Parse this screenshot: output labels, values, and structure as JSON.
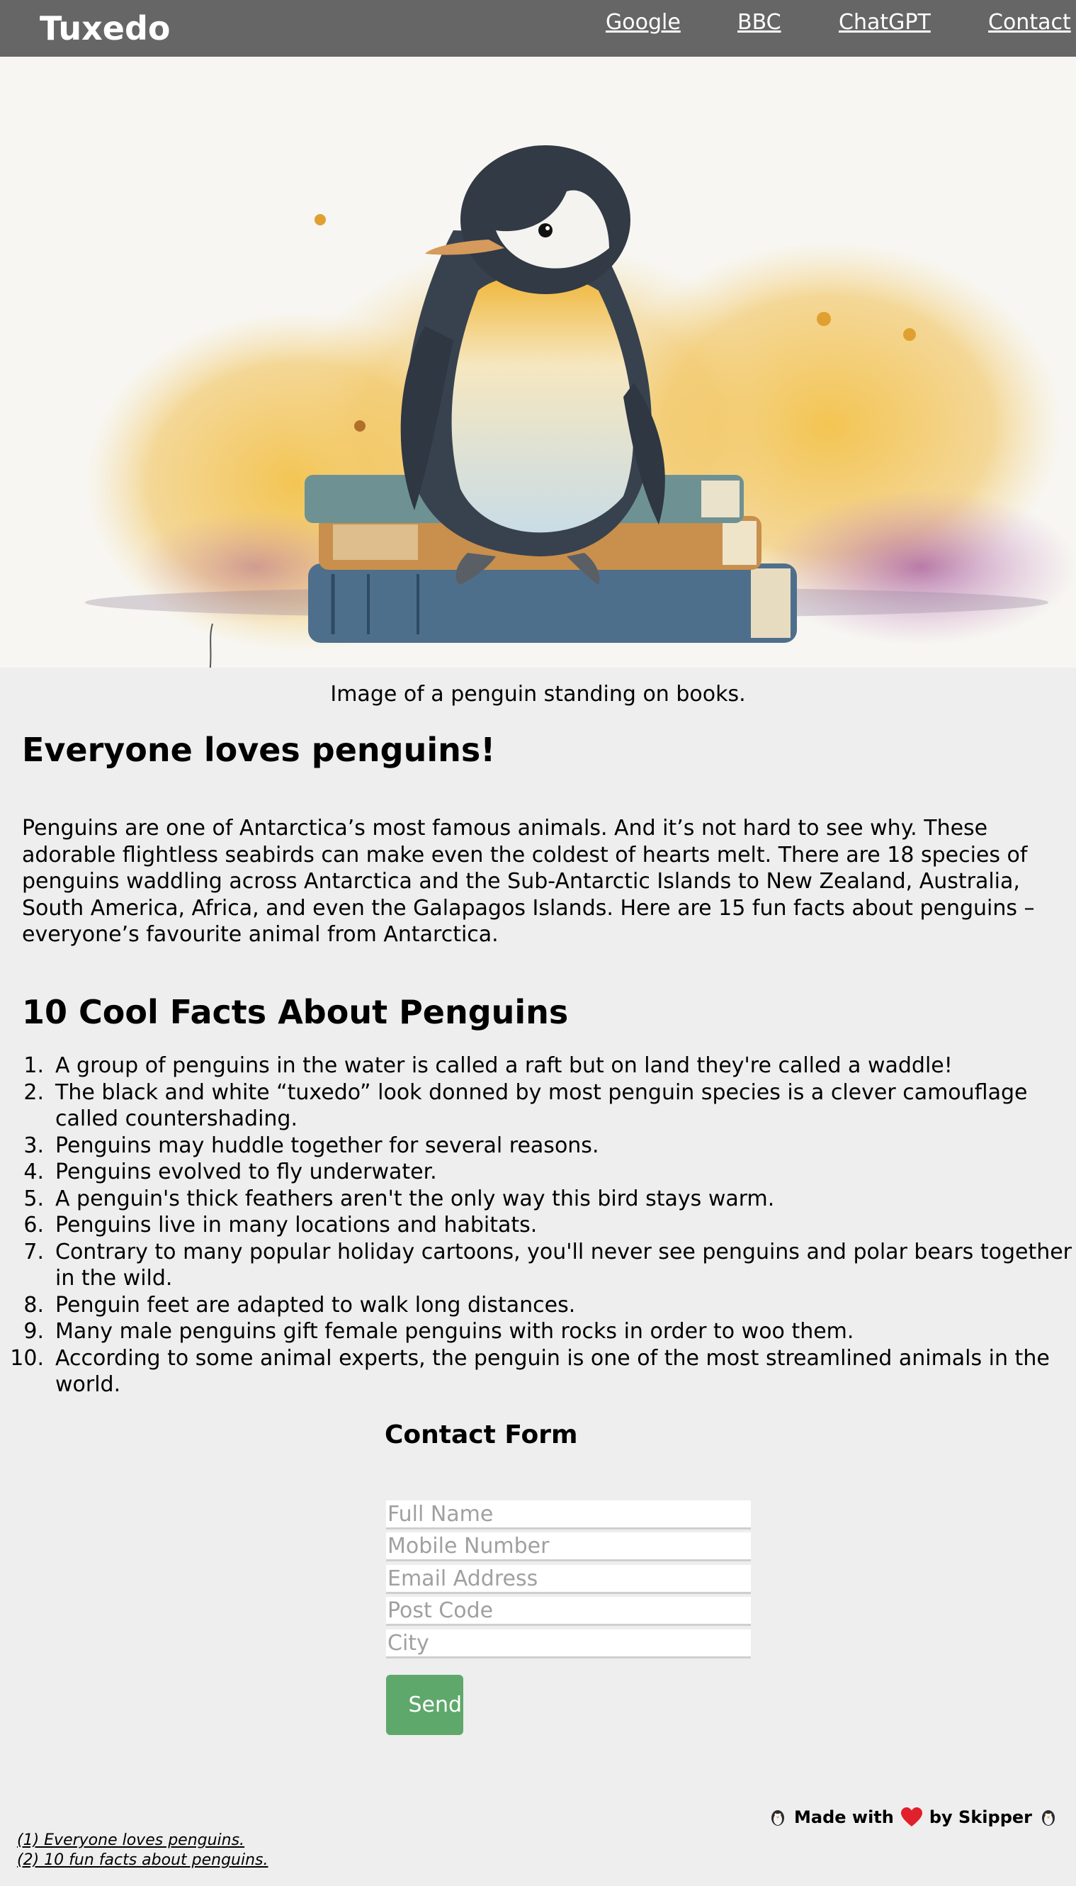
{
  "navbar": {
    "brand": "Tuxedo",
    "links": [
      {
        "label": "Google"
      },
      {
        "label": "BBC"
      },
      {
        "label": "ChatGPT"
      },
      {
        "label": "Contact"
      }
    ],
    "background": "#666666"
  },
  "hero": {
    "caption": "Image of a penguin standing on books."
  },
  "article": {
    "heading": "Everyone loves penguins!",
    "intro": "Penguins are one of Antarctica’s most famous animals. And it’s not hard to see why. These adorable flightless seabirds can make even the coldest of hearts melt. There are 18 species of penguins waddling across Antarctica and the Sub-Antarctic Islands to New Zealand, Australia, South America, Africa, and even the Galapagos Islands. Here are 15 fun facts about penguins – everyone’s favourite animal from Antarctica.",
    "facts_heading": "10 Cool Facts About Penguins",
    "facts": [
      {
        "num": "1.",
        "text": "A group of penguins in the water is called a raft but on land they're called a waddle!"
      },
      {
        "num": "2.",
        "text": "The black and white “tuxedo” look donned by most penguin species is a clever camouflage called countershading."
      },
      {
        "num": "3.",
        "text": "Penguins may huddle together for several reasons."
      },
      {
        "num": "4.",
        "text": "Penguins evolved to fly underwater."
      },
      {
        "num": "5.",
        "text": "A penguin's thick feathers aren't the only way this bird stays warm."
      },
      {
        "num": "6.",
        "text": "Penguins live in many locations and habitats."
      },
      {
        "num": "7.",
        "text": "Contrary to many popular holiday cartoons, you'll never see penguins and polar bears together in the wild."
      },
      {
        "num": "8.",
        "text": "Penguin feet are adapted to walk long distances."
      },
      {
        "num": "9.",
        "text": "Many male penguins gift female penguins with rocks in order to woo them."
      },
      {
        "num": "10.",
        "text": "According to some animal experts, the penguin is one of the most streamlined animals in the world."
      }
    ]
  },
  "contact_form": {
    "title": "Contact Form",
    "fields": {
      "full_name": {
        "placeholder": "Full Name",
        "value": ""
      },
      "mobile": {
        "placeholder": "Mobile Number",
        "value": ""
      },
      "email": {
        "placeholder": "Email Address",
        "value": ""
      },
      "post_code": {
        "placeholder": "Post Code",
        "value": ""
      },
      "city": {
        "placeholder": "City",
        "value": ""
      }
    },
    "send_label": "Send",
    "send_color": "#5fa86b"
  },
  "footer": {
    "made_with_prefix": "Made with",
    "made_with_suffix": "by Skipper",
    "icons": [
      "penguin-icon",
      "heart-icon",
      "penguin-icon"
    ],
    "references": [
      "(1) Everyone loves penguins.",
      "(2) 10 fun facts about penguins."
    ]
  }
}
